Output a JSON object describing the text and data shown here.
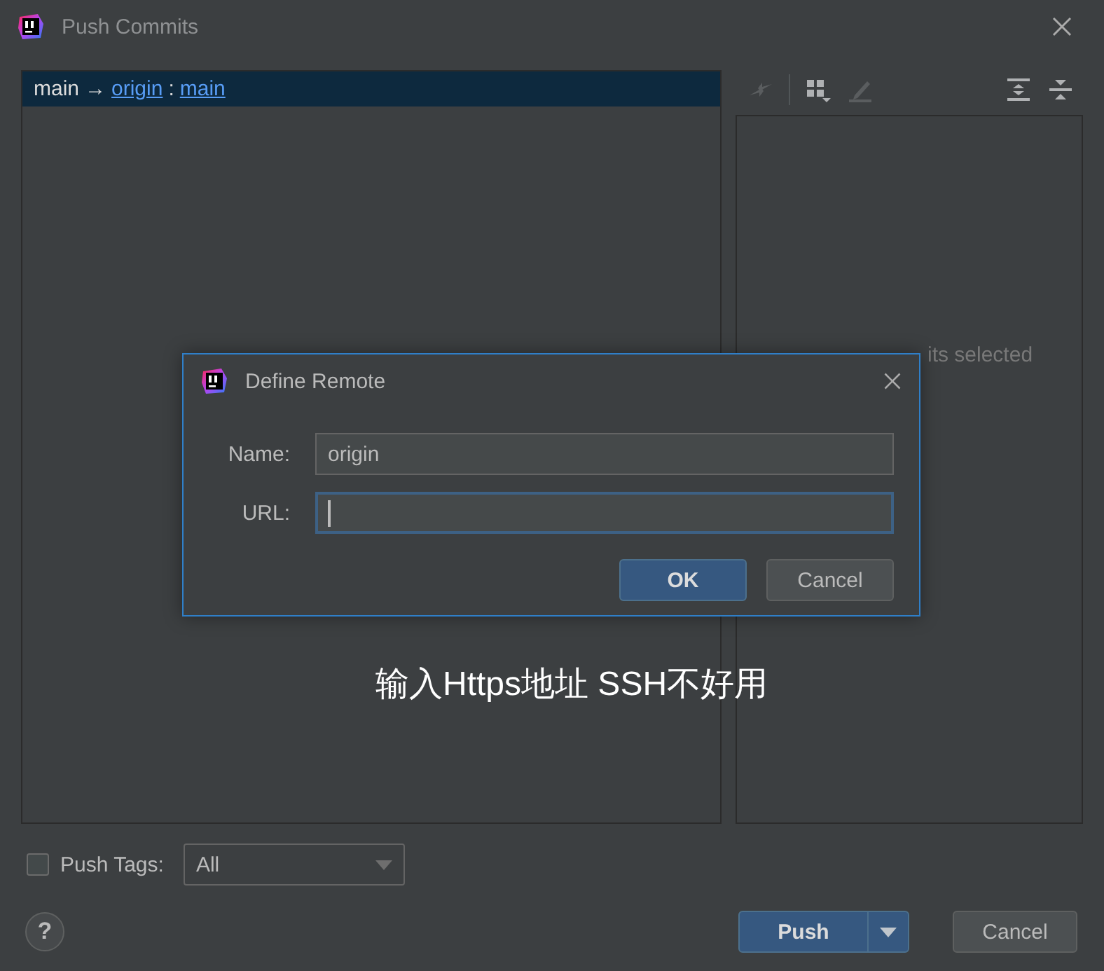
{
  "window": {
    "title": "Push Commits"
  },
  "branch_row": {
    "local": "main",
    "arrow": "→",
    "remote": "origin",
    "separator": ":",
    "remote_branch": "main",
    "selected": true
  },
  "toolbar": [
    {
      "kind": "merge",
      "disabled": true
    },
    {
      "kind": "grid-menu",
      "disabled": false
    },
    {
      "kind": "edit",
      "disabled": true
    },
    {
      "kind": "expand-all",
      "disabled": false
    },
    {
      "kind": "collapse-all",
      "disabled": false
    }
  ],
  "details_panel": {
    "message": "its selected"
  },
  "annotation": "输入Https地址 SSH不好用",
  "push_tags": {
    "label": "Push Tags:",
    "checked": false,
    "dropdown": "All"
  },
  "help": "?",
  "buttons": {
    "push": "Push",
    "cancel": "Cancel"
  },
  "dialog": {
    "title": "Define Remote",
    "fields": [
      {
        "label": "Name:",
        "value": "origin",
        "focused": false
      },
      {
        "label": "URL:",
        "focused": true
      }
    ],
    "buttons": [
      {
        "label": "OK",
        "default": true
      },
      {
        "label": "Cancel",
        "default": false
      }
    ]
  }
}
